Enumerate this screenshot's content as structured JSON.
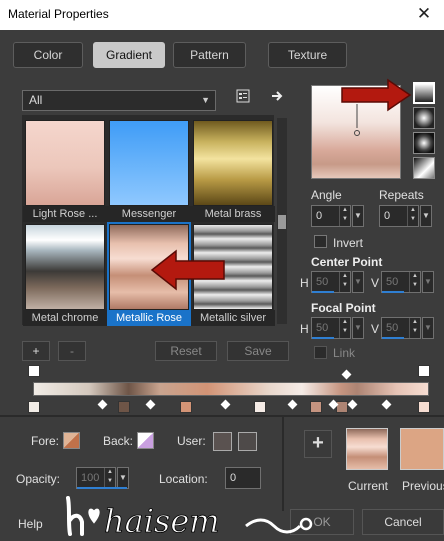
{
  "window": {
    "title": "Material Properties",
    "close_glyph": "✕"
  },
  "tabs": [
    {
      "label": "Color"
    },
    {
      "label": "Gradient",
      "active": true
    },
    {
      "label": "Pattern"
    },
    {
      "label": "Texture"
    }
  ],
  "library": {
    "category": "All"
  },
  "gradients": [
    {
      "label": "Light Rose ..."
    },
    {
      "label": "Messenger"
    },
    {
      "label": "Metal brass"
    },
    {
      "label": "Metal chrome"
    },
    {
      "label": "Metallic Rose",
      "selected": true
    },
    {
      "label": "Metallic silver"
    }
  ],
  "params": {
    "angle_label": "Angle",
    "angle": "0",
    "repeats_label": "Repeats",
    "repeats": "0",
    "invert_label": "Invert",
    "center_label": "Center Point",
    "center_h": "50",
    "center_v": "50",
    "focal_label": "Focal Point",
    "focal_h": "50",
    "focal_v": "50",
    "link_label": "Link",
    "h_letter": "H",
    "v_letter": "V"
  },
  "editor": {
    "add": "+",
    "remove": "-",
    "reset": "Reset",
    "save": "Save"
  },
  "footer": {
    "fore_label": "Fore:",
    "back_label": "Back:",
    "user_label": "User:",
    "opacity_label": "Opacity:",
    "opacity": "100",
    "location_label": "Location:",
    "location": "0",
    "current_label": "Current",
    "previous_label": "Previous",
    "help": "Help",
    "ok": "OK",
    "cancel": "Cancel",
    "plus": "+"
  },
  "watermark": {
    "text": "haisem"
  },
  "colors": {
    "accent": "#1a73c9",
    "arrow": "#b3190f"
  }
}
